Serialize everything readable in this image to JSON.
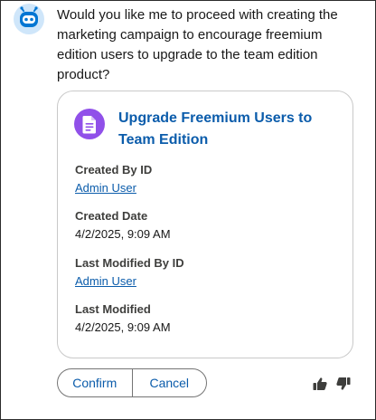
{
  "message": {
    "text": "Would you like me to proceed with creating the marketing campaign to encourage freemium edition users to upgrade to the team edition product?"
  },
  "icons": {
    "avatar": "bot-avatar-icon",
    "record": "document-icon",
    "thumbs_up": "thumbs-up-icon",
    "thumbs_down": "thumbs-down-icon"
  },
  "colors": {
    "link": "#0b5cab",
    "record_icon": "#9050e9",
    "avatar_bg": "#cfe6fa",
    "avatar_fg": "#0176d3"
  },
  "record": {
    "title": "Upgrade Freemium Users to Team Edition",
    "fields": [
      {
        "label": "Created By ID",
        "value": "Admin User",
        "is_link": true
      },
      {
        "label": "Created Date",
        "value": "4/2/2025, 9:09 AM",
        "is_link": false
      },
      {
        "label": "Last Modified By ID",
        "value": "Admin User",
        "is_link": true
      },
      {
        "label": "Last Modified",
        "value": "4/2/2025, 9:09 AM",
        "is_link": false
      }
    ]
  },
  "actions": {
    "confirm_label": "Confirm",
    "cancel_label": "Cancel"
  }
}
